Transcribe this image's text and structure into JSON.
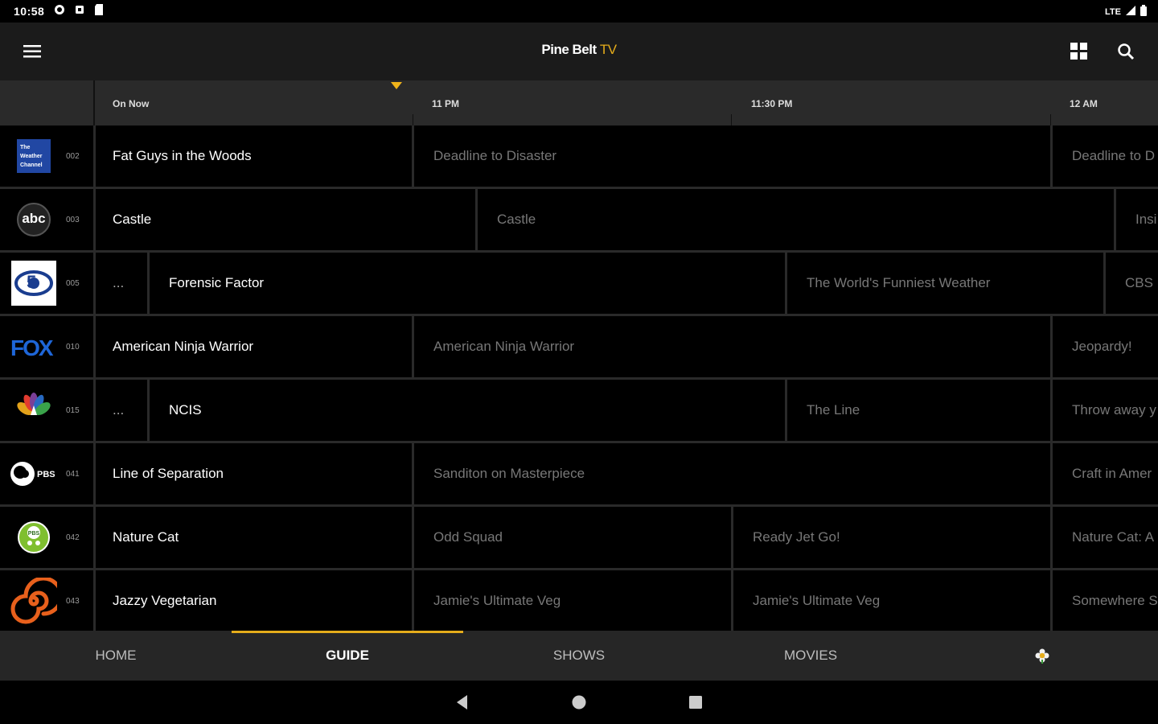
{
  "status_bar": {
    "time": "10:58",
    "network": "LTE"
  },
  "app": {
    "title_main": "Pine Belt",
    "title_accent": "TV"
  },
  "timeline": {
    "labels": [
      "On Now",
      "11 PM",
      "11:30 PM",
      "12 AM"
    ]
  },
  "channels": [
    {
      "number": "002",
      "logo": "weather-channel-logo",
      "logo_text": "The Weather Channel",
      "programs": [
        {
          "title": "Fat Guys in the Woods",
          "state": "now"
        },
        {
          "title": "Deadline to Disaster",
          "state": "future"
        },
        {
          "title": "Deadline to D",
          "state": "future"
        }
      ]
    },
    {
      "number": "003",
      "logo": "abc-logo",
      "logo_text": "abc",
      "programs": [
        {
          "title": "Castle",
          "state": "now"
        },
        {
          "title": "Castle",
          "state": "future"
        },
        {
          "title": "Insi",
          "state": "future"
        }
      ]
    },
    {
      "number": "005",
      "logo": "cbs5-logo",
      "logo_text": "5",
      "programs": [
        {
          "title": "...",
          "state": "stub"
        },
        {
          "title": "Forensic Factor",
          "state": "now"
        },
        {
          "title": "The World's Funniest Weather",
          "state": "future"
        },
        {
          "title": "CBS I",
          "state": "future"
        }
      ]
    },
    {
      "number": "010",
      "logo": "fox-logo",
      "logo_text": "FOX",
      "programs": [
        {
          "title": "American Ninja Warrior",
          "state": "now"
        },
        {
          "title": "American Ninja Warrior",
          "state": "future"
        },
        {
          "title": "Jeopardy!",
          "state": "future"
        }
      ]
    },
    {
      "number": "015",
      "logo": "nbc-logo",
      "logo_text": "NBC",
      "programs": [
        {
          "title": "...",
          "state": "stub"
        },
        {
          "title": "NCIS",
          "state": "now"
        },
        {
          "title": "The Line",
          "state": "future"
        },
        {
          "title": "Throw away y",
          "state": "future"
        }
      ]
    },
    {
      "number": "041",
      "logo": "pbs-logo",
      "logo_text": "PBS",
      "programs": [
        {
          "title": "Line of Separation",
          "state": "now"
        },
        {
          "title": "Sanditon on Masterpiece",
          "state": "future"
        },
        {
          "title": "Craft in Amer",
          "state": "future"
        }
      ]
    },
    {
      "number": "042",
      "logo": "pbs-kids-logo",
      "logo_text": "PBS",
      "programs": [
        {
          "title": "Nature Cat",
          "state": "now"
        },
        {
          "title": "Odd Squad",
          "state": "future"
        },
        {
          "title": "Ready Jet Go!",
          "state": "future"
        },
        {
          "title": "Nature Cat: A",
          "state": "future"
        }
      ]
    },
    {
      "number": "043",
      "logo": "create-tv-logo",
      "logo_text": "",
      "programs": [
        {
          "title": "Jazzy Vegetarian",
          "state": "now"
        },
        {
          "title": "Jamie's Ultimate Veg",
          "state": "future"
        },
        {
          "title": "Jamie's Ultimate Veg",
          "state": "future"
        },
        {
          "title": "Somewhere S",
          "state": "future"
        }
      ]
    }
  ],
  "bottom_nav": {
    "tabs": [
      "HOME",
      "GUIDE",
      "SHOWS",
      "MOVIES"
    ],
    "active": "GUIDE",
    "extra_icon": "flower-icon"
  },
  "colors": {
    "accent": "#e5ac1b",
    "bar": "#1b1b1b",
    "background": "#000000"
  }
}
